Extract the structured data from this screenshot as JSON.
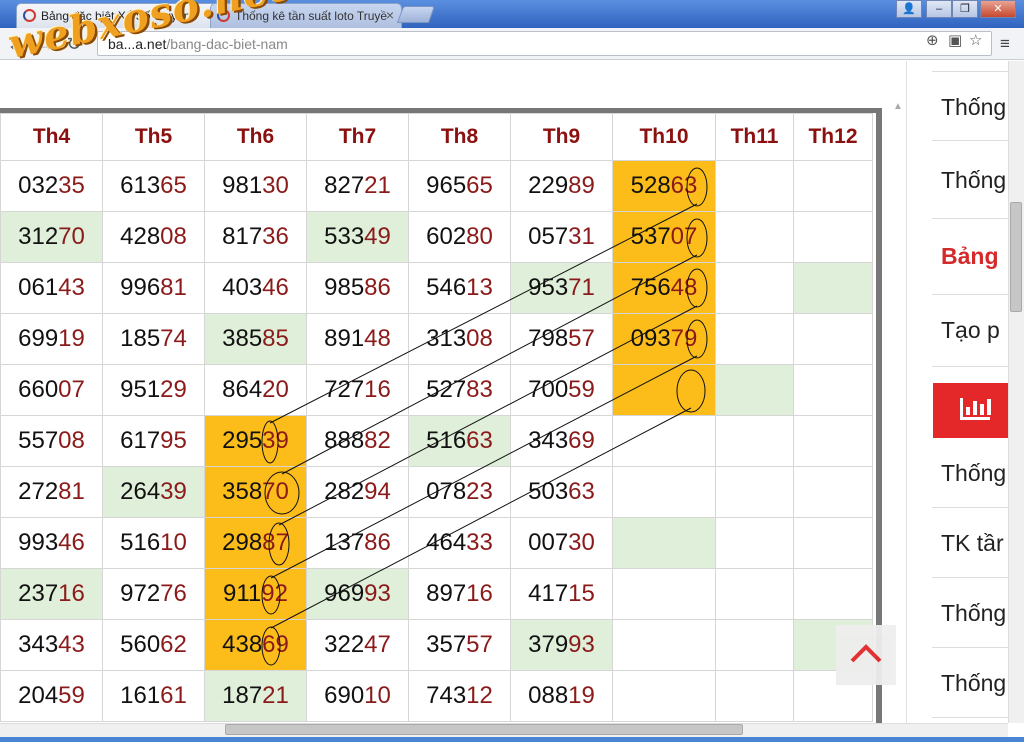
{
  "browser": {
    "tabs": [
      {
        "title": "Bảng đặc biệt Xổ Số Truyền",
        "active": true
      },
      {
        "title": "Thống kê tần suất loto Truyề",
        "active": false
      }
    ],
    "url_host": "ba...a.net",
    "url_path": "/bang-dac-biet-nam",
    "watermark": "webxoso.net"
  },
  "table": {
    "headers": [
      "Th4",
      "Th5",
      "Th6",
      "Th7",
      "Th8",
      "Th9",
      "Th10",
      "Th11",
      "Th12"
    ],
    "rows": [
      [
        {
          "v": "032",
          "t": "35"
        },
        {
          "v": "613",
          "t": "65"
        },
        {
          "v": "981",
          "t": "30"
        },
        {
          "v": "827",
          "t": "21"
        },
        {
          "v": "965",
          "t": "65"
        },
        {
          "v": "229",
          "t": "89"
        },
        {
          "v": "528",
          "t": "63",
          "c": "orange"
        },
        {
          "v": "",
          "t": ""
        },
        {
          "v": "",
          "t": ""
        }
      ],
      [
        {
          "v": "312",
          "t": "70",
          "c": "green"
        },
        {
          "v": "428",
          "t": "08"
        },
        {
          "v": "817",
          "t": "36"
        },
        {
          "v": "533",
          "t": "49",
          "c": "green"
        },
        {
          "v": "602",
          "t": "80"
        },
        {
          "v": "057",
          "t": "31"
        },
        {
          "v": "537",
          "t": "07",
          "c": "orange"
        },
        {
          "v": "",
          "t": ""
        },
        {
          "v": "",
          "t": ""
        }
      ],
      [
        {
          "v": "061",
          "t": "43"
        },
        {
          "v": "996",
          "t": "81"
        },
        {
          "v": "403",
          "t": "46"
        },
        {
          "v": "985",
          "t": "86"
        },
        {
          "v": "546",
          "t": "13"
        },
        {
          "v": "953",
          "t": "71",
          "c": "green"
        },
        {
          "v": "756",
          "t": "48",
          "c": "orange"
        },
        {
          "v": "",
          "t": ""
        },
        {
          "v": "",
          "t": "",
          "c": "green"
        }
      ],
      [
        {
          "v": "699",
          "t": "19"
        },
        {
          "v": "185",
          "t": "74"
        },
        {
          "v": "385",
          "t": "85",
          "c": "green"
        },
        {
          "v": "891",
          "t": "48"
        },
        {
          "v": "313",
          "t": "08"
        },
        {
          "v": "798",
          "t": "57"
        },
        {
          "v": "093",
          "t": "79",
          "c": "orange"
        },
        {
          "v": "",
          "t": ""
        },
        {
          "v": "",
          "t": ""
        }
      ],
      [
        {
          "v": "660",
          "t": "07"
        },
        {
          "v": "951",
          "t": "29"
        },
        {
          "v": "864",
          "t": "20"
        },
        {
          "v": "727",
          "t": "16"
        },
        {
          "v": "527",
          "t": "83"
        },
        {
          "v": "700",
          "t": "59"
        },
        {
          "v": "",
          "t": "",
          "c": "orange"
        },
        {
          "v": "",
          "t": "",
          "c": "green"
        },
        {
          "v": "",
          "t": ""
        }
      ],
      [
        {
          "v": "557",
          "t": "08"
        },
        {
          "v": "617",
          "t": "95"
        },
        {
          "v": "295",
          "t": "39",
          "c": "orange"
        },
        {
          "v": "888",
          "t": "82"
        },
        {
          "v": "516",
          "t": "63",
          "c": "green"
        },
        {
          "v": "343",
          "t": "69"
        },
        {
          "v": "",
          "t": ""
        },
        {
          "v": "",
          "t": ""
        },
        {
          "v": "",
          "t": ""
        }
      ],
      [
        {
          "v": "272",
          "t": "81"
        },
        {
          "v": "264",
          "t": "39",
          "c": "green"
        },
        {
          "v": "358",
          "t": "70",
          "c": "orange"
        },
        {
          "v": "282",
          "t": "94"
        },
        {
          "v": "078",
          "t": "23"
        },
        {
          "v": "503",
          "t": "63"
        },
        {
          "v": "",
          "t": ""
        },
        {
          "v": "",
          "t": ""
        },
        {
          "v": "",
          "t": ""
        }
      ],
      [
        {
          "v": "993",
          "t": "46"
        },
        {
          "v": "516",
          "t": "10"
        },
        {
          "v": "298",
          "t": "87",
          "c": "orange"
        },
        {
          "v": "137",
          "t": "86"
        },
        {
          "v": "464",
          "t": "33"
        },
        {
          "v": "007",
          "t": "30"
        },
        {
          "v": "",
          "t": "",
          "c": "green"
        },
        {
          "v": "",
          "t": ""
        },
        {
          "v": "",
          "t": ""
        }
      ],
      [
        {
          "v": "237",
          "t": "16",
          "c": "green"
        },
        {
          "v": "972",
          "t": "76"
        },
        {
          "v": "911",
          "t": "92",
          "c": "orange"
        },
        {
          "v": "969",
          "t": "93",
          "c": "green"
        },
        {
          "v": "897",
          "t": "16"
        },
        {
          "v": "417",
          "t": "15"
        },
        {
          "v": "",
          "t": ""
        },
        {
          "v": "",
          "t": ""
        },
        {
          "v": "",
          "t": ""
        }
      ],
      [
        {
          "v": "343",
          "t": "43"
        },
        {
          "v": "560",
          "t": "62"
        },
        {
          "v": "438",
          "t": "69",
          "c": "orange"
        },
        {
          "v": "322",
          "t": "47"
        },
        {
          "v": "357",
          "t": "57"
        },
        {
          "v": "379",
          "t": "93",
          "c": "green"
        },
        {
          "v": "",
          "t": ""
        },
        {
          "v": "",
          "t": ""
        },
        {
          "v": "",
          "t": "",
          "c": "green"
        }
      ],
      [
        {
          "v": "204",
          "t": "59"
        },
        {
          "v": "161",
          "t": "61"
        },
        {
          "v": "187",
          "t": "21",
          "c": "green"
        },
        {
          "v": "690",
          "t": "10"
        },
        {
          "v": "743",
          "t": "12"
        },
        {
          "v": "088",
          "t": "19"
        },
        {
          "v": "",
          "t": ""
        },
        {
          "v": "",
          "t": ""
        },
        {
          "v": "",
          "t": ""
        }
      ]
    ]
  },
  "sidebar": {
    "items": [
      "Thống",
      "Thống",
      "Bảng",
      "Tạo p",
      "Thống",
      "TK tầr",
      "Thống",
      "Thống"
    ]
  },
  "colors": {
    "orange": "#fcbc1a",
    "green": "#dfefd9",
    "accent": "#e4282a",
    "header_text": "#8b1010"
  }
}
